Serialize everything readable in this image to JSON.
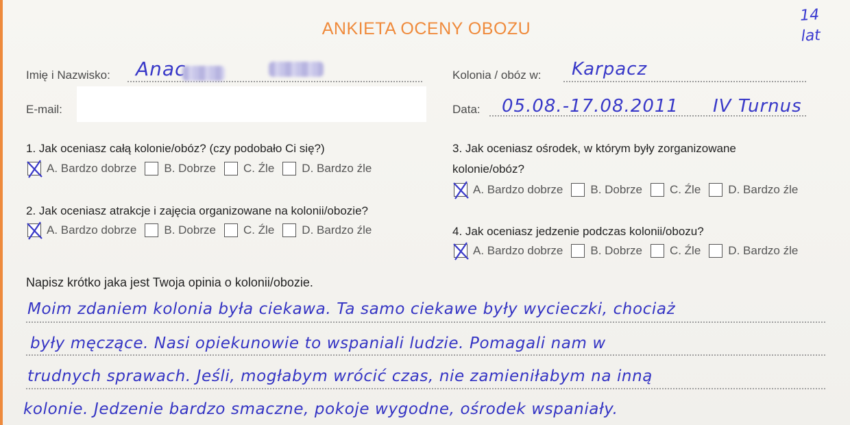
{
  "form": {
    "title": "ANKIETA OCENY OBOZU",
    "corner_note": [
      "14",
      "lat"
    ],
    "fields": {
      "name_label": "Imię i Nazwisko:",
      "name_value": "Anac",
      "email_label": "E-mail:",
      "camp_label": "Kolonia / obóz w:",
      "camp_value": "Karpacz",
      "date_label": "Data:",
      "date_value": "05.08.-17.08.2011",
      "turnus_value": "IV Turnus"
    },
    "questions": [
      {
        "number": "1.",
        "text": "Jak oceniasz całą kolonie/obóz? (czy podobało Ci się?)",
        "checked": 0
      },
      {
        "number": "2.",
        "text": "Jak oceniasz atrakcje i zajęcia organizowane na kolonii/obozie?",
        "checked": 0
      },
      {
        "number": "3.",
        "text": "Jak oceniasz ośrodek, w którym były zorganizowane",
        "text2": "kolonie/obóz?",
        "checked": 0
      },
      {
        "number": "4.",
        "text": "Jak oceniasz jedzenie podczas kolonii/obozu?",
        "checked": 0
      }
    ],
    "options": [
      "A. Bardzo dobrze",
      "B. Dobrze",
      "C. Źle",
      "D. Bardzo źle"
    ],
    "opinion": {
      "prompt": "Napisz krótko jaka jest Twoja opinia o kolonii/obozie.",
      "lines": [
        "Moim zdaniem kolonia była ciekawa. Ta samo ciekawe były wycieczki, chociaż",
        "były męczące. Nasi opiekunowie to wspaniali ludzie. Pomagali nam w",
        "trudnych sprawach. Jeśli, mogłabym wrócić czas, nie zamieniłabym na inną",
        "kolonie. Jedzenie bardzo smaczne, pokoje wygodne, ośrodek wspaniały."
      ]
    }
  },
  "colors": {
    "accent": "#ef8a3b",
    "ink": "#3838c8"
  }
}
